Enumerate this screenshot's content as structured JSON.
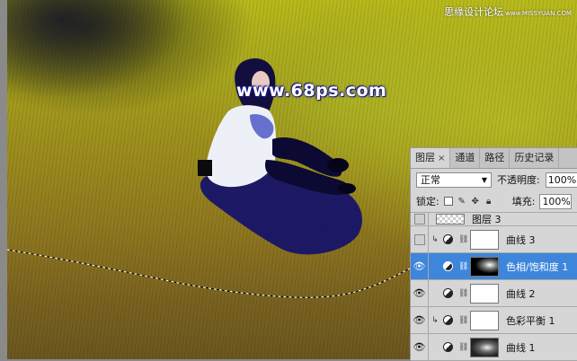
{
  "canvas": {
    "watermark": "www.68ps.com",
    "site_brand": "思缘设计论坛",
    "site_url": "www.MISSYUAN.COM"
  },
  "panel": {
    "tabs": [
      {
        "label": "图层",
        "active": true,
        "close": "×"
      },
      {
        "label": "通道",
        "active": false
      },
      {
        "label": "路径",
        "active": false
      },
      {
        "label": "历史记录",
        "active": false
      }
    ],
    "blend_mode": "正常",
    "opacity_label": "不透明度:",
    "opacity_value": "100%",
    "lock_label": "锁定:",
    "fill_label": "填充:",
    "fill_value": "100%"
  },
  "layers": [
    {
      "name": "图层 3",
      "visible": false,
      "partial": true
    },
    {
      "name": "曲线 3",
      "visible": false,
      "clipped": true,
      "type": "curves"
    },
    {
      "name": "色相/饱和度 1",
      "visible": true,
      "selected": true,
      "type": "hue-saturation"
    },
    {
      "name": "曲线 2",
      "visible": true,
      "type": "curves"
    },
    {
      "name": "色彩平衡 1",
      "visible": true,
      "clipped": true,
      "type": "color-balance"
    },
    {
      "name": "曲线 1",
      "visible": true,
      "type": "curves"
    }
  ],
  "colors": {
    "selection": "#3d86db",
    "panel_bg": "#d6d6d6"
  }
}
